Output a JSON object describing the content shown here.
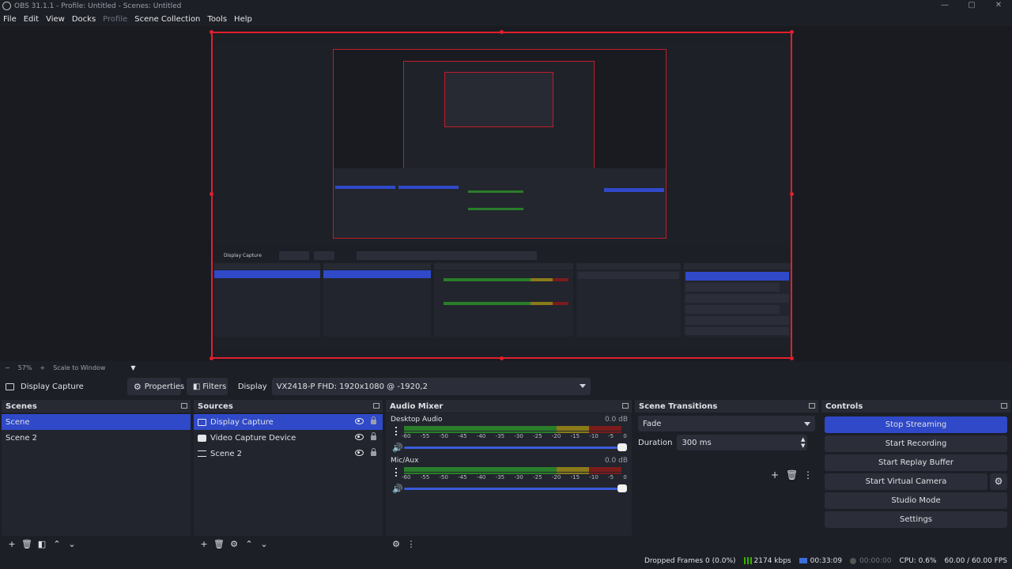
{
  "window": {
    "title": "OBS 31.1.1 - Profile: Untitled - Scenes: Untitled",
    "controls": [
      "—",
      "▢",
      "✕"
    ]
  },
  "menu": {
    "file": "File",
    "edit": "Edit",
    "view": "View",
    "docks": "Docks",
    "profile": "Profile",
    "scene_collection": "Scene Collection",
    "tools": "Tools",
    "help": "Help"
  },
  "zoom": {
    "minus": "−",
    "level": "57%",
    "plus": "+",
    "scale_mode": "Scale to Window"
  },
  "context": {
    "source_name": "Display Capture",
    "properties_label": "Properties",
    "filters_label": "Filters",
    "display_label": "Display",
    "display_value": "VX2418-P FHD: 1920x1080 @ -1920,2"
  },
  "scenes": {
    "title": "Scenes",
    "items": [
      {
        "label": "Scene"
      },
      {
        "label": "Scene 2"
      }
    ]
  },
  "sources": {
    "title": "Sources",
    "items": [
      {
        "label": "Display Capture"
      },
      {
        "label": "Video Capture Device"
      },
      {
        "label": "Scene 2"
      }
    ]
  },
  "mixer": {
    "title": "Audio Mixer",
    "channels": [
      {
        "name": "Desktop Audio",
        "db": "0.0 dB"
      },
      {
        "name": "Mic/Aux",
        "db": "0.0 dB"
      }
    ],
    "scale": [
      "-60",
      "-55",
      "-50",
      "-45",
      "-40",
      "-35",
      "-30",
      "-25",
      "-20",
      "-15",
      "-10",
      "-5",
      "0"
    ]
  },
  "transitions": {
    "title": "Scene Transitions",
    "selected": "Fade",
    "duration_label": "Duration",
    "duration_value": "300 ms"
  },
  "controls": {
    "title": "Controls",
    "stop_streaming": "Stop Streaming",
    "start_recording": "Start Recording",
    "start_replay_buffer": "Start Replay Buffer",
    "start_virtual_camera": "Start Virtual Camera",
    "studio_mode": "Studio Mode",
    "settings": "Settings"
  },
  "status": {
    "dropped_frames": "Dropped Frames 0 (0.0%)",
    "bitrate": "2174 kbps",
    "stream_time": "00:33:09",
    "record_time": "00:00:00",
    "cpu": "CPU: 0.6%",
    "fps": "60.00 / 60.00 FPS"
  },
  "colors": {
    "accent": "#2f49c8",
    "selection_border": "#e0202d",
    "meter_green": "#2a7d2a",
    "meter_yellow": "#8a7a1a",
    "meter_red": "#7a1c1c"
  }
}
